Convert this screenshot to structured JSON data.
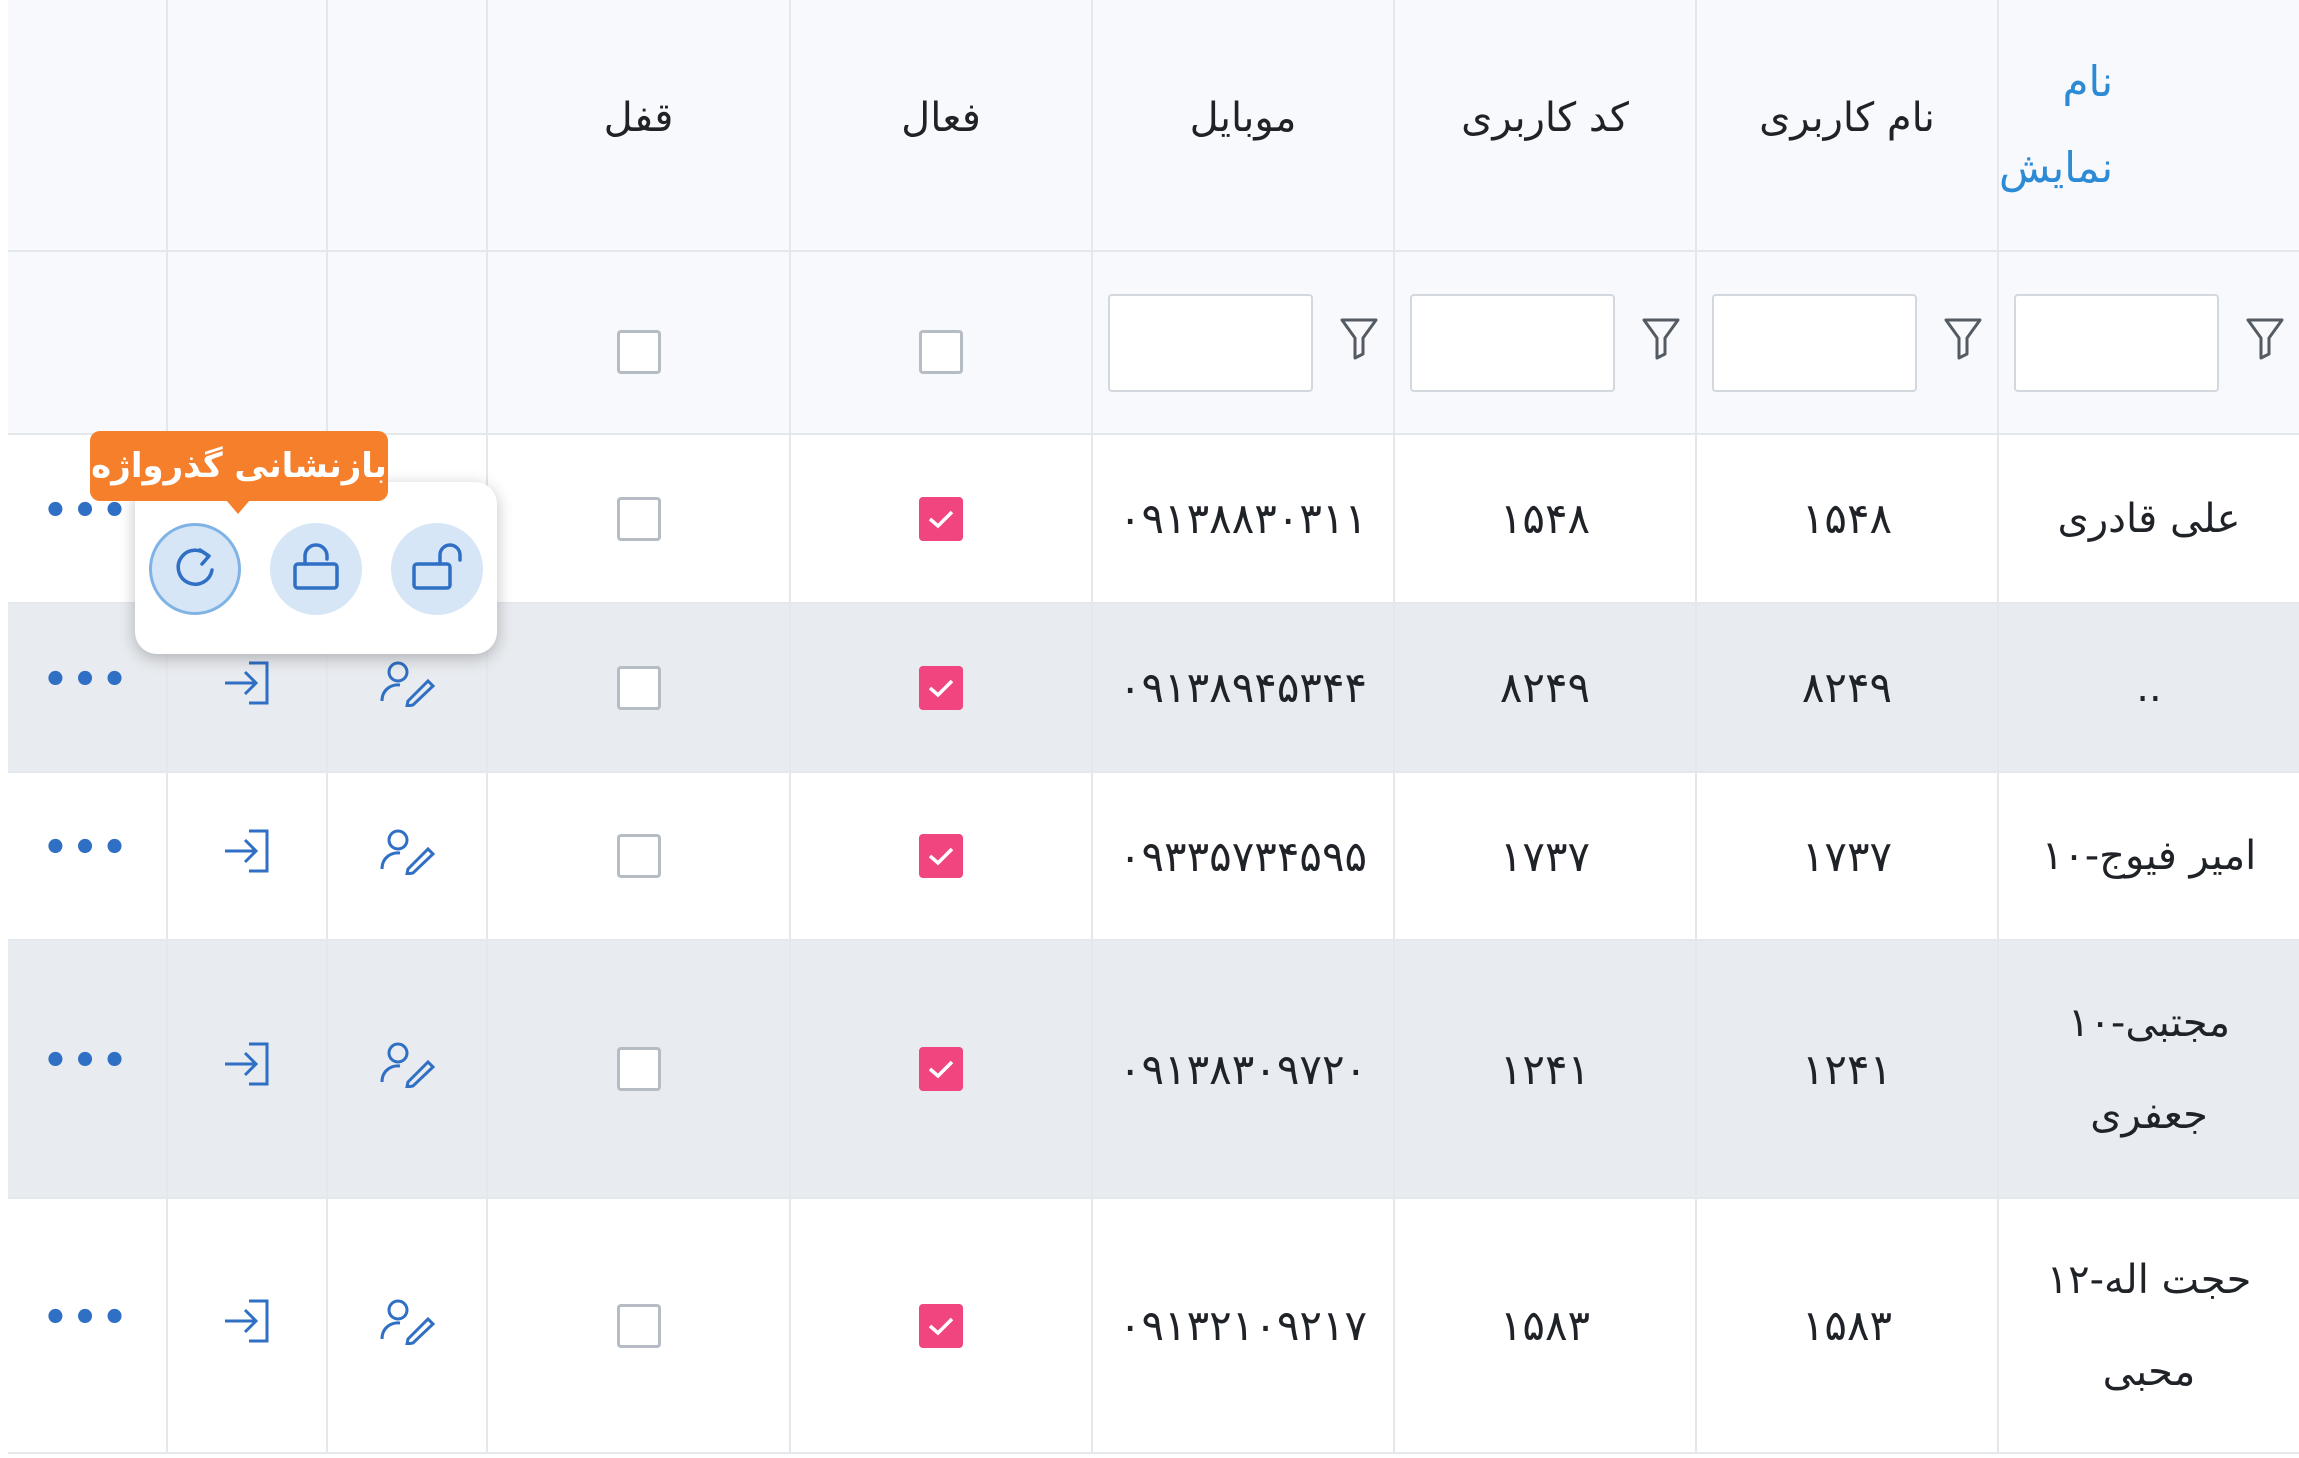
{
  "colors": {
    "accent": "#2d8bd6",
    "checked": "#f0457f",
    "tooltip": "#f57f2a",
    "icon": "#2f6fc4"
  },
  "columns": {
    "display_name_1": "نام",
    "display_name_2": "نمایش",
    "username": "نام کاربری",
    "user_code": "کد کاربری",
    "mobile": "موبایل",
    "active": "فعال",
    "lock": "قفل"
  },
  "rows": [
    {
      "name_1": "علی قادری",
      "name_2": "",
      "username": "۱۵۴۸",
      "code": "۱۵۴۸",
      "mobile": "۰۹۱۳۸۸۳۰۳۱۱",
      "active": true,
      "lock": false
    },
    {
      "name_1": "..",
      "name_2": "",
      "username": "۸۲۴۹",
      "code": "۸۲۴۹",
      "mobile": "۰۹۱۳۸۹۴۵۳۴۴",
      "active": true,
      "lock": false
    },
    {
      "name_1": "امیر فیوج-۱۰",
      "name_2": "",
      "username": "۱۷۳۷",
      "code": "۱۷۳۷",
      "mobile": "۰۹۳۳۵۷۳۴۵۹۵",
      "active": true,
      "lock": false
    },
    {
      "name_1": "مجتبی-۱۰",
      "name_2": "جعفری",
      "username": "۱۲۴۱",
      "code": "۱۲۴۱",
      "mobile": "۰۹۱۳۸۳۰۹۷۲۰",
      "active": true,
      "lock": false
    },
    {
      "name_1": "حجت اله-۱۲",
      "name_2": "محبی",
      "username": "۱۵۸۳",
      "code": "۱۵۸۳",
      "mobile": "۰۹۱۳۲۱۰۹۲۱۷",
      "active": true,
      "lock": false
    }
  ],
  "popup": {
    "tooltip": "بازنشانی گذرواژه",
    "buttons": [
      "refresh-icon",
      "lock-open-icon",
      "unlock-icon"
    ]
  },
  "row_actions": {
    "more": "•••"
  }
}
